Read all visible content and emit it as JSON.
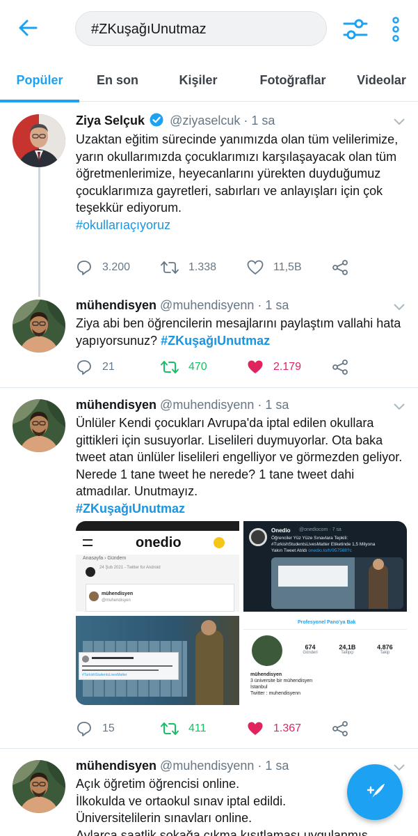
{
  "search": {
    "query": "#ZKuşağıUnutmaz"
  },
  "icons": {
    "back": "arrow-left-icon",
    "filter": "sliders-icon",
    "more": "more-vertical-icon",
    "reply": "reply-icon",
    "retweet": "retweet-icon",
    "like": "heart-icon",
    "share": "share-icon",
    "compose": "compose-icon"
  },
  "colors": {
    "accent": "#1da1f2",
    "retweet_active": "#17bf63",
    "like_active": "#e0245e",
    "muted": "#657786"
  },
  "tabs": [
    {
      "label": "Popüler",
      "active": true
    },
    {
      "label": "En son",
      "active": false
    },
    {
      "label": "Kişiler",
      "active": false
    },
    {
      "label": "Fotoğraflar",
      "active": false
    },
    {
      "label": "Videolar",
      "active": false
    }
  ],
  "tweets": [
    {
      "name": "Ziya Selçuk",
      "verified": true,
      "handle": "@ziyaselcuk",
      "time": "· 1 sa",
      "text": "Uzaktan eğitim sürecinde yanımızda olan tüm velilerimize, yarın okullarımızda çocuklarımızı karşılaşayacak olan tüm öğretmenlerimize, heyecanlarını yürekten duyduğumuz çocuklarımıza gayretleri, sabırları ve anlayışları için çok teşekkür ediyorum.",
      "hashtag": "#okullarıaçıyoruz",
      "replies": "3.200",
      "retweets": "1.338",
      "likes": "11,5B"
    },
    {
      "name": "mühendisyen",
      "handle": "@muhendisyenn",
      "time": "· 1 sa",
      "text": "Ziya abi ben öğrencilerin mesajlarını paylaştım vallahi hata yapıyorsunuz?",
      "hashtag": "#ZKuşağıUnutmaz",
      "replies": "21",
      "retweets": "470",
      "likes": "2.179"
    },
    {
      "name": "mühendisyen",
      "handle": "@muhendisyenn",
      "time": "· 1 sa",
      "text": "Ünlüler Kendi çocukları Avrupa'da iptal edilen okullara gittikleri için susuyorlar. Liselileri duymuyorlar. Ota baka tweet atan ünlüler liselileri engelliyor ve görmezden geliyor. Nerede 1 tane tweet he nerede? 1 tane tweet dahi atmadılar. Unutmayız.",
      "hashtag": "#ZKuşağıUnutmaz",
      "replies": "15",
      "retweets": "411",
      "likes": "1.367",
      "media": {
        "m1": {
          "logo": "onedio",
          "crumb": "Anasayfa  ›  Gündem",
          "date": "24 Şub 2021 - Twitter for Android",
          "user": "mühendisyen",
          "user_handle": "@muhendisyen"
        },
        "m2": {
          "account": "Onedio",
          "account_handle": "@onediocom · 7 sa",
          "line1": "Öğrenciler Yüz Yüze Sınavlara Tepkili:",
          "line2": "#TurkishStudentsLivesMatter Etiketinde 1,5 Milyona",
          "line3": "Yakın Tweet Atıldı",
          "link": "onedio.to/h/957588?c"
        },
        "m3": {
          "tag": "#TurkishStudentsLivesMatter"
        },
        "m4": {
          "header": "Profesyonel Pano'ya Bak",
          "stats": [
            {
              "n": "674",
              "l": "Gönderi"
            },
            {
              "n": "24,1B",
              "l": "Takipçi"
            },
            {
              "n": "4.876",
              "l": "Takip"
            }
          ],
          "name": "mühendisyen",
          "bio": "3 üniversite bir mühendisyen",
          "city": "İstanbul",
          "twitter": "Twitter : muhendisyenn"
        }
      }
    },
    {
      "name": "mühendisyen",
      "handle": "@muhendisyenn",
      "time": "· 1 sa",
      "lines": [
        "Açık öğretim öğrencisi online.",
        "İlkokulda ve ortaokul sınav iptal edildi.",
        "Üniversitelilerin sınavları online.",
        "Aylarca saatlik sokağa çıkma kısıtlaması uygulanmış"
      ]
    }
  ]
}
